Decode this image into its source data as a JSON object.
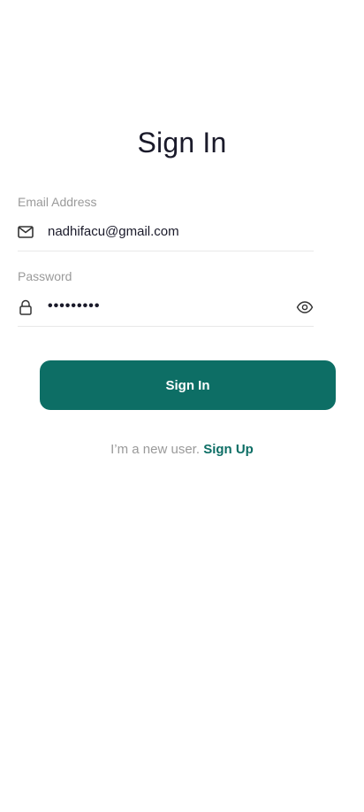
{
  "header": {
    "title": "Sign In"
  },
  "email": {
    "label": "Email Address",
    "value": "nadhifacu@gmail.com",
    "icon": "mail-icon"
  },
  "password": {
    "label": "Password",
    "value": "•••••••••",
    "icon": "lock-icon",
    "toggle_icon": "eye-icon"
  },
  "actions": {
    "signin_label": "Sign In"
  },
  "footer": {
    "prompt": "I’m a new user.",
    "signup_label": "Sign Up"
  },
  "colors": {
    "accent": "#0d6e65",
    "text": "#1a1a2a",
    "muted": "#9a9a9a"
  }
}
